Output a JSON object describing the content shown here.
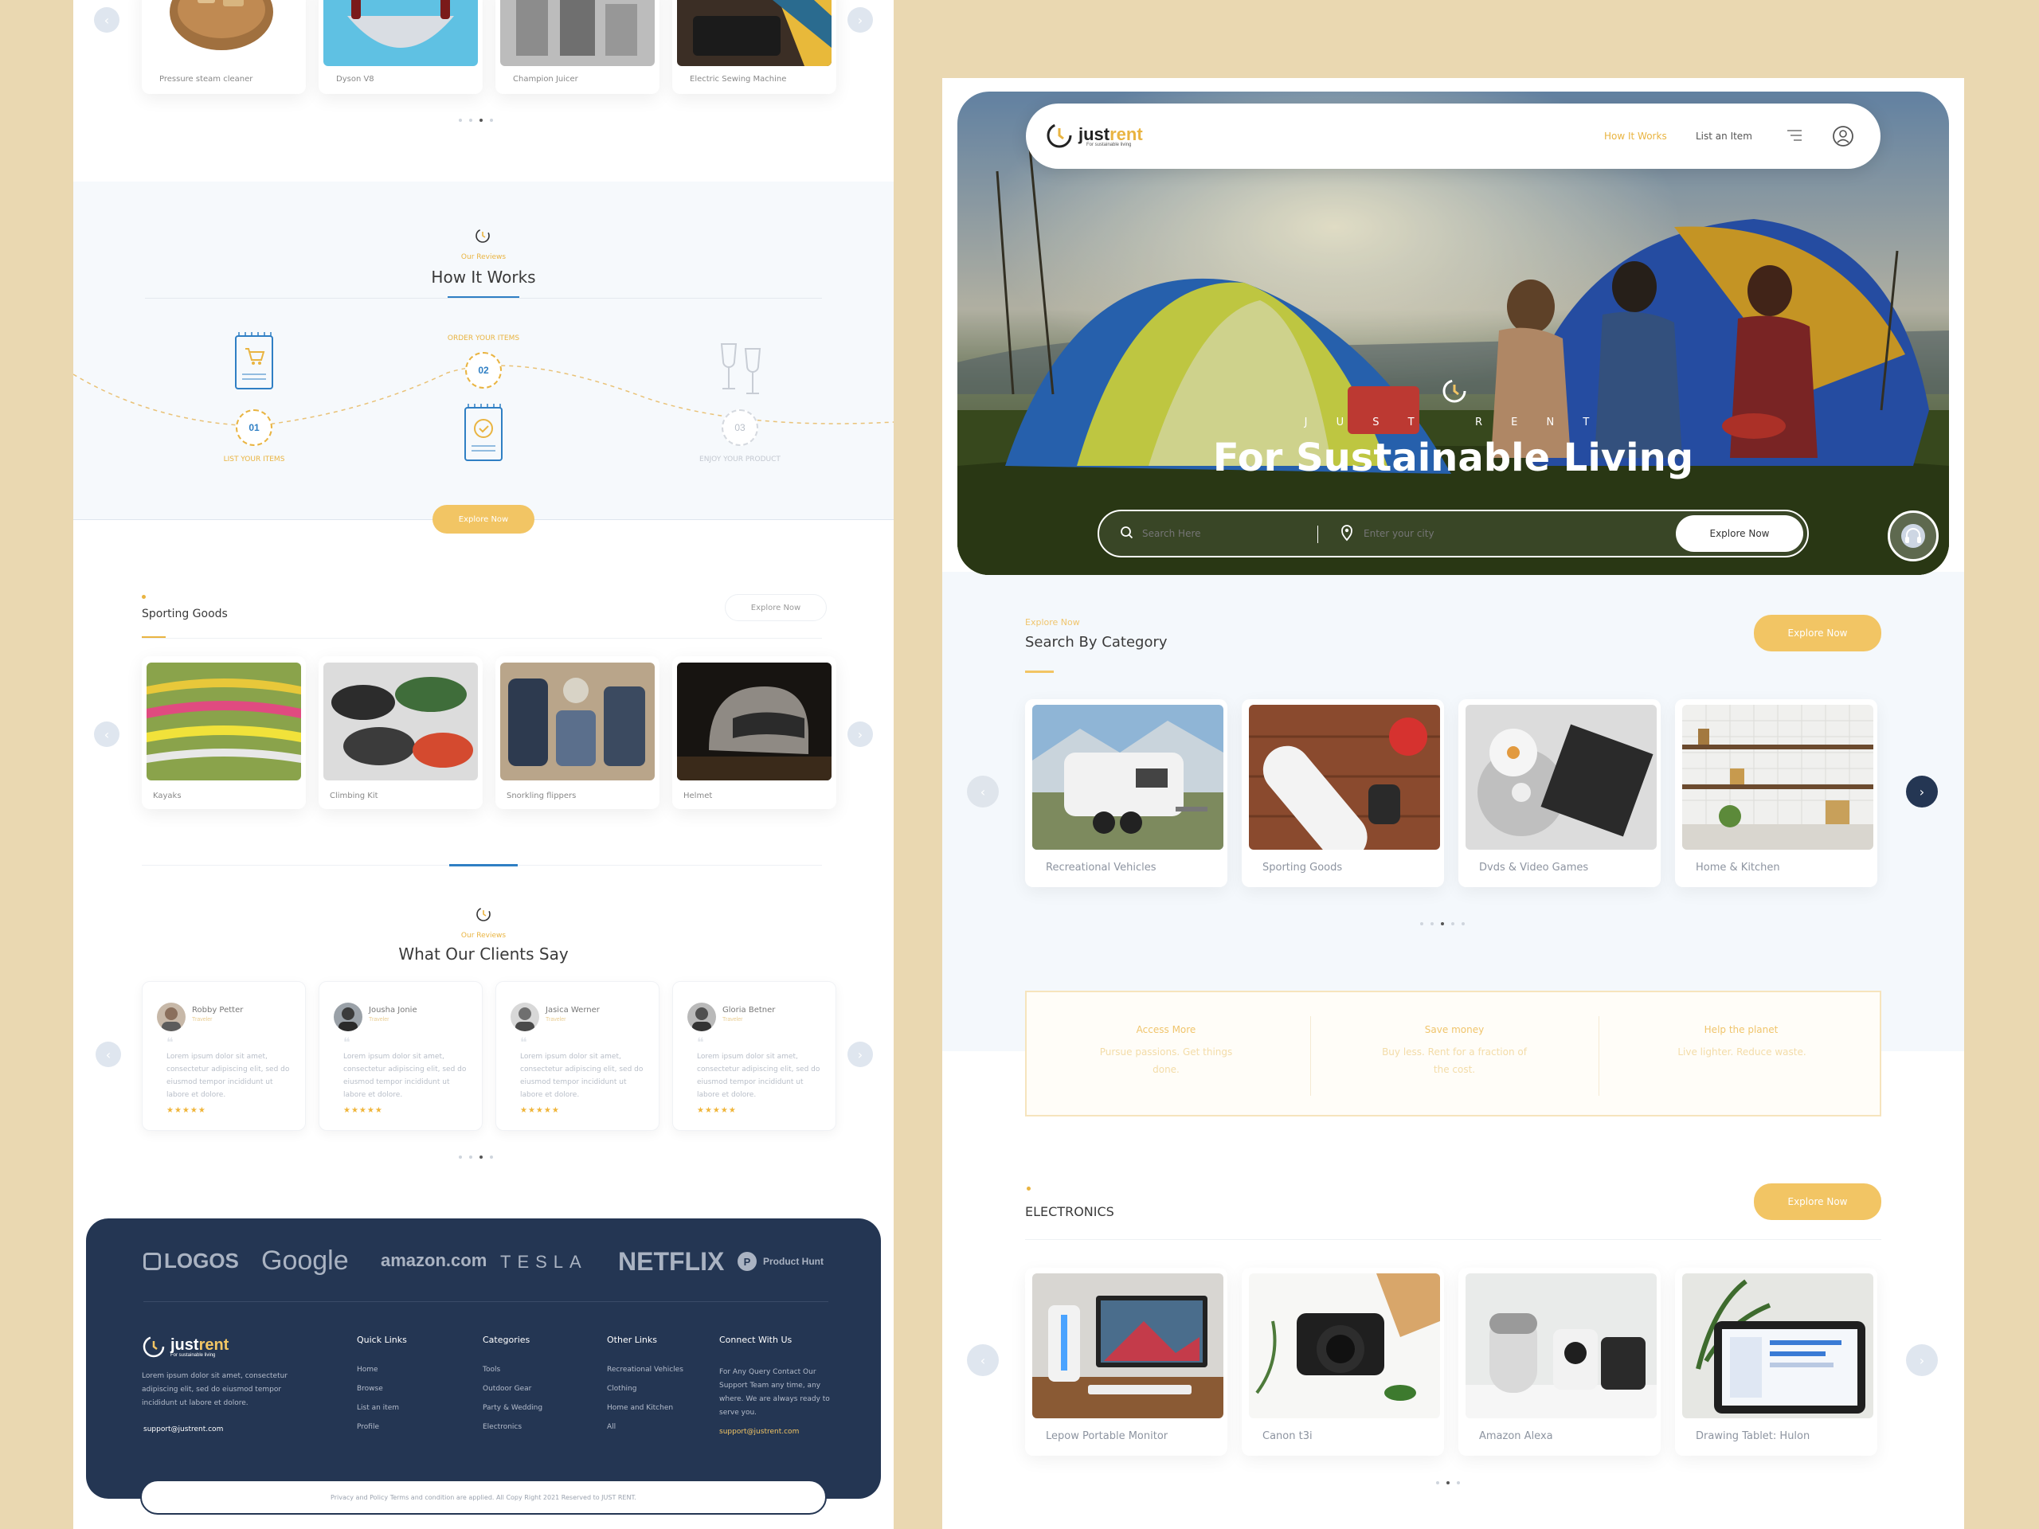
{
  "left": {
    "top_products": [
      {
        "name": "Pressure steam cleaner",
        "icon": "bread-board-image"
      },
      {
        "name": "Dyson V8",
        "icon": "mezzaluna-knife-image"
      },
      {
        "name": "Champion Juicer",
        "icon": "kitchen-appliances-image"
      },
      {
        "name": "Electric Sewing Machine",
        "icon": "sewing-machine-image"
      }
    ],
    "how": {
      "kicker": "Our Reviews",
      "title": "How It Works",
      "steps": [
        {
          "num": "01",
          "label": "LIST YOUR ITEMS"
        },
        {
          "num": "02",
          "label": "ORDER YOUR ITEMS"
        },
        {
          "num": "03",
          "label": "ENJOY YOUR PRODUCT"
        }
      ],
      "button": "Explore Now"
    },
    "sporting": {
      "title": "Sporting Goods",
      "button": "Explore Now",
      "items": [
        {
          "name": "Kayaks"
        },
        {
          "name": "Climbing Kit"
        },
        {
          "name": "Snorkling flippers"
        },
        {
          "name": "Helmet"
        }
      ]
    },
    "clients": {
      "kicker": "Our Reviews",
      "title": "What Our Clients Say",
      "reviews": [
        {
          "name": "Robby Petter",
          "role": "Traveler",
          "text": "Lorem ipsum dolor sit amet, consectetur adipiscing elit, sed do eiusmod tempor incididunt ut labore et dolore.",
          "stars": "★★★★★"
        },
        {
          "name": "Jousha Jonie",
          "role": "Traveler",
          "text": "Lorem ipsum dolor sit amet, consectetur adipiscing elit, sed do eiusmod tempor incididunt ut labore et dolore.",
          "stars": "★★★★★"
        },
        {
          "name": "Jasica Werner",
          "role": "Traveler",
          "text": "Lorem ipsum dolor sit amet, consectetur adipiscing elit, sed do eiusmod tempor incididunt ut labore et dolore.",
          "stars": "★★★★★"
        },
        {
          "name": "Gloria Betner",
          "role": "Traveler",
          "text": "Lorem ipsum dolor sit amet, consectetur adipiscing elit, sed do eiusmod tempor incididunt ut labore et dolore.",
          "stars": "★★★★★"
        }
      ]
    },
    "footer": {
      "brands": [
        "LOGOS",
        "Google",
        "amazon.com",
        "TESLA",
        "NETFLIX",
        "Product Hunt"
      ],
      "logo_main": "just",
      "logo_accent": "rent",
      "tagline": "For sustainable living",
      "about": "Lorem ipsum dolor sit amet, consectetur adipiscing elit, sed do eiusmod tempor incididunt ut labore et dolore.",
      "email": "support@justrent.com",
      "cols": [
        {
          "head": "Quick Links",
          "links": [
            "Home",
            "Browse",
            "List an item",
            "Profile"
          ]
        },
        {
          "head": "Categories",
          "links": [
            "Tools",
            "Outdoor Gear",
            "Party & Wedding",
            "Electronics"
          ]
        },
        {
          "head": "Other Links",
          "links": [
            "Recreational Vehicles",
            "Clothing",
            "Home and Kitchen",
            "All"
          ]
        }
      ],
      "connect_head": "Connect With Us",
      "connect_text": "For Any Query Contact Our Support Team any time, any where. We are always ready to serve you.",
      "connect_email": "support@justrent.com",
      "copyright": "Privacy and Policy Terms and condition are applied. All Copy Right 2021 Reserved to JUST RENT."
    }
  },
  "right": {
    "nav": {
      "logo_main": "just",
      "logo_accent": "rent",
      "tagline": "For sustainable living",
      "link1": "How It Works",
      "link2": "List an Item"
    },
    "hero": {
      "kicker": "J U S T   R E N T",
      "title": "For Sustainable Living",
      "search_placeholder": "Search Here",
      "city_placeholder": "Enter your city",
      "button": "Explore Now"
    },
    "category": {
      "kicker": "Explore Now",
      "title": "Search By Category",
      "button": "Explore Now",
      "items": [
        {
          "name": "Recreational Vehicles"
        },
        {
          "name": "Sporting Goods"
        },
        {
          "name": "Dvds & Video Games"
        },
        {
          "name": "Home & Kitchen"
        }
      ]
    },
    "features": [
      {
        "title": "Access More",
        "text": "Pursue passions. Get things done."
      },
      {
        "title": "Save money",
        "text": "Buy less. Rent for a fraction of the cost."
      },
      {
        "title": "Help the planet",
        "text": "Live lighter. Reduce waste."
      }
    ],
    "electronics": {
      "title": "ELECTRONICS",
      "button": "Explore Now",
      "items": [
        {
          "name": "Lepow Portable Monitor"
        },
        {
          "name": "Canon t3i"
        },
        {
          "name": "Amazon Alexa"
        },
        {
          "name": "Drawing Tablet: Hulon"
        }
      ]
    }
  },
  "colors": {
    "accent": "#f2c564",
    "navy": "#243653",
    "page_bg": "#ead8b1",
    "blue": "#2f7fc4"
  }
}
